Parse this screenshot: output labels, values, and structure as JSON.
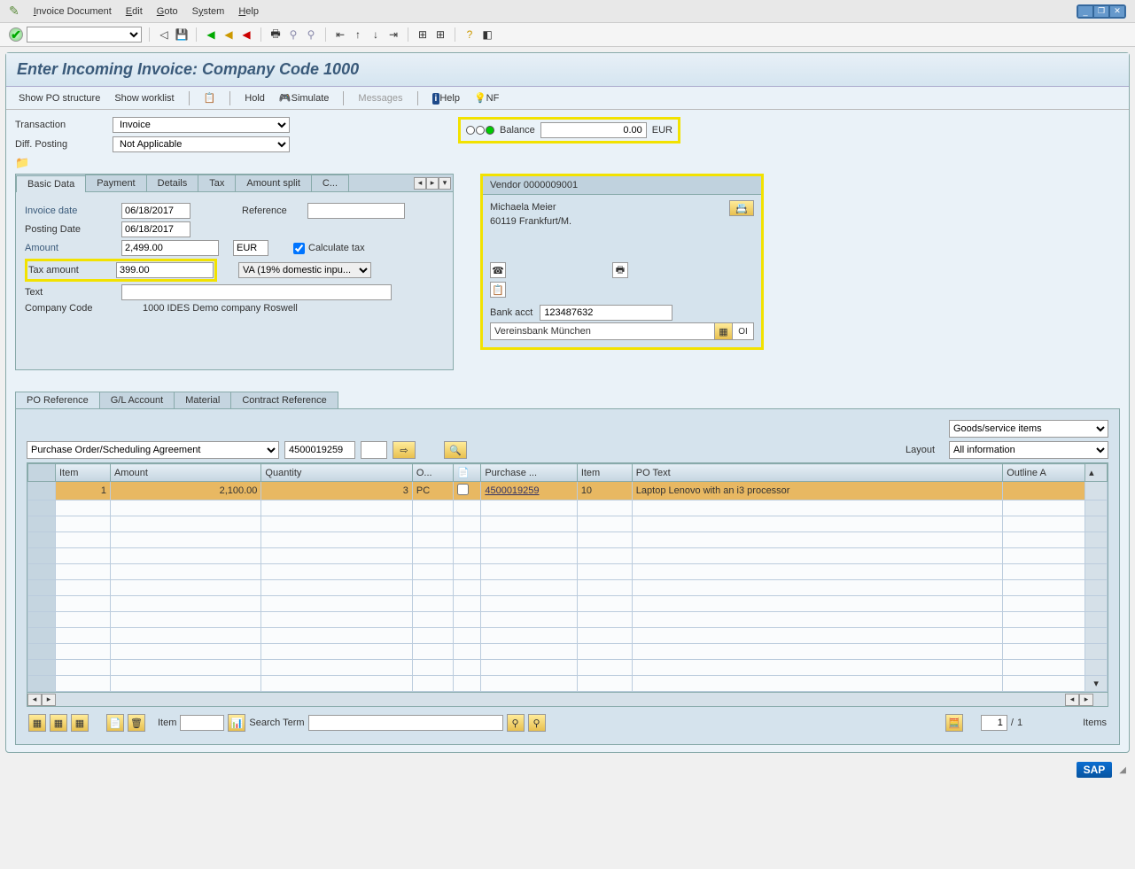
{
  "menu": {
    "items": [
      "Invoice Document",
      "Edit",
      "Goto",
      "System",
      "Help"
    ]
  },
  "page_title": "Enter Incoming Invoice: Company Code 1000",
  "app_toolbar": {
    "show_po_structure": "Show PO structure",
    "show_worklist": "Show worklist",
    "hold": "Hold",
    "simulate": "Simulate",
    "messages": "Messages",
    "help": "Help",
    "nf": "NF"
  },
  "transaction": {
    "label": "Transaction",
    "value": "Invoice"
  },
  "diff_posting": {
    "label": "Diff. Posting",
    "value": "Not Applicable"
  },
  "balance": {
    "label": "Balance",
    "value": "0.00",
    "currency": "EUR"
  },
  "basic_tabs": [
    "Basic Data",
    "Payment",
    "Details",
    "Tax",
    "Amount split",
    "C..."
  ],
  "basic": {
    "invoice_date_label": "Invoice date",
    "invoice_date": "06/18/2017",
    "reference_label": "Reference",
    "reference": "",
    "posting_date_label": "Posting Date",
    "posting_date": "06/18/2017",
    "amount_label": "Amount",
    "amount": "2,499.00",
    "currency": "EUR",
    "calc_tax_label": "Calculate tax",
    "tax_amount_label": "Tax amount",
    "tax_amount": "399.00",
    "tax_code": "VA (19% domestic inpu...",
    "text_label": "Text",
    "text": "",
    "company_code_label": "Company Code",
    "company_code": "1000 IDES Demo company Roswell"
  },
  "vendor": {
    "header": "Vendor 0000009001",
    "name": "Michaela Meier",
    "city": "60119 Frankfurt/M.",
    "bank_acct_label": "Bank acct",
    "bank_acct": "123487632",
    "bank_name": "Vereinsbank München",
    "oi": "OI"
  },
  "po_tabs": [
    "PO Reference",
    "G/L Account",
    "Material",
    "Contract Reference"
  ],
  "po": {
    "ref_type": "Purchase Order/Scheduling Agreement",
    "po_number": "4500019259",
    "goods_service": "Goods/service items",
    "layout_label": "Layout",
    "layout": "All information"
  },
  "grid": {
    "headers": {
      "item": "Item",
      "amount": "Amount",
      "quantity": "Quantity",
      "ou": "O...",
      "flag": "",
      "purchase": "Purchase ...",
      "po_item": "Item",
      "po_text": "PO Text",
      "outline": "Outline A"
    },
    "rows": [
      {
        "item": "1",
        "amount": "2,100.00",
        "quantity": "3",
        "ou": "PC",
        "purchase": "4500019259",
        "po_item": "10",
        "po_text": "Laptop Lenovo with an i3 processor"
      }
    ]
  },
  "bottom": {
    "item_label": "Item",
    "item_value": "",
    "search_label": "Search Term",
    "search_value": "",
    "page": "1",
    "page_sep": "/",
    "page_total": "1",
    "items_label": "Items"
  },
  "sap": "SAP"
}
